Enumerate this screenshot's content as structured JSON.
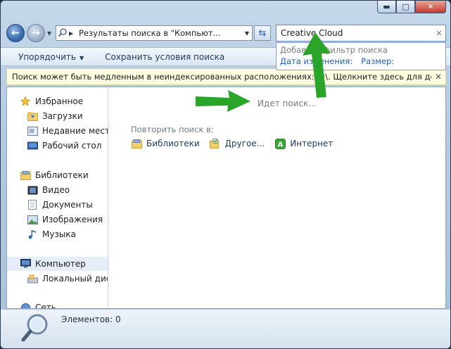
{
  "window": {
    "caption": {
      "minimize": "▬",
      "maximize": "□",
      "close": "✕"
    }
  },
  "nav": {
    "back_icon": "back-arrow-icon",
    "forward_icon": "forward-arrow-icon",
    "address_text": "Результаты поиска в \"Компьют...",
    "search_value": "Creative Cloud"
  },
  "suggest": {
    "title": "Добавить фильтр поиска",
    "filters": [
      "Дата изменения:",
      "Размер:"
    ]
  },
  "toolbar": {
    "organize": "Упорядочить",
    "save_search": "Сохранить условия поиска"
  },
  "infobar": {
    "text": "Поиск может быть медленным в неиндексированных расположениях: C:\\. Щелкните здесь для добавле...",
    "close": "✕"
  },
  "sidebar": {
    "items": [
      {
        "label": "Избранное",
        "icon": "star-icon",
        "level": 1
      },
      {
        "label": "Загрузки",
        "icon": "downloads-folder-icon",
        "level": 2
      },
      {
        "label": "Недавние места",
        "icon": "recent-places-icon",
        "level": 2
      },
      {
        "label": "Рабочий стол",
        "icon": "desktop-icon",
        "level": 2
      },
      {
        "label": "Библиотеки",
        "icon": "libraries-icon",
        "level": 1
      },
      {
        "label": "Видео",
        "icon": "video-icon",
        "level": 2
      },
      {
        "label": "Документы",
        "icon": "documents-icon",
        "level": 2
      },
      {
        "label": "Изображения",
        "icon": "pictures-icon",
        "level": 2
      },
      {
        "label": "Музыка",
        "icon": "music-icon",
        "level": 2
      },
      {
        "label": "Компьютер",
        "icon": "computer-icon",
        "level": 1
      },
      {
        "label": "Локальный диск",
        "icon": "local-disk-icon",
        "level": 2
      },
      {
        "label": "Сеть",
        "icon": "network-icon",
        "level": 1
      }
    ]
  },
  "main": {
    "status": "Идет поиск...",
    "repeat_label": "Повторить поиск в:",
    "repeat_links": [
      {
        "label": "Библиотеки",
        "icon": "libraries-icon"
      },
      {
        "label": "Другое...",
        "icon": "other-folder-icon"
      },
      {
        "label": "Интернет",
        "icon": "internet-icon"
      }
    ]
  },
  "details": {
    "count": "Элементов: 0"
  },
  "colors": {
    "annotation_arrow": "#2aa52a",
    "link": "#1f5fb7",
    "infobar_bg": "#ffffe1"
  }
}
